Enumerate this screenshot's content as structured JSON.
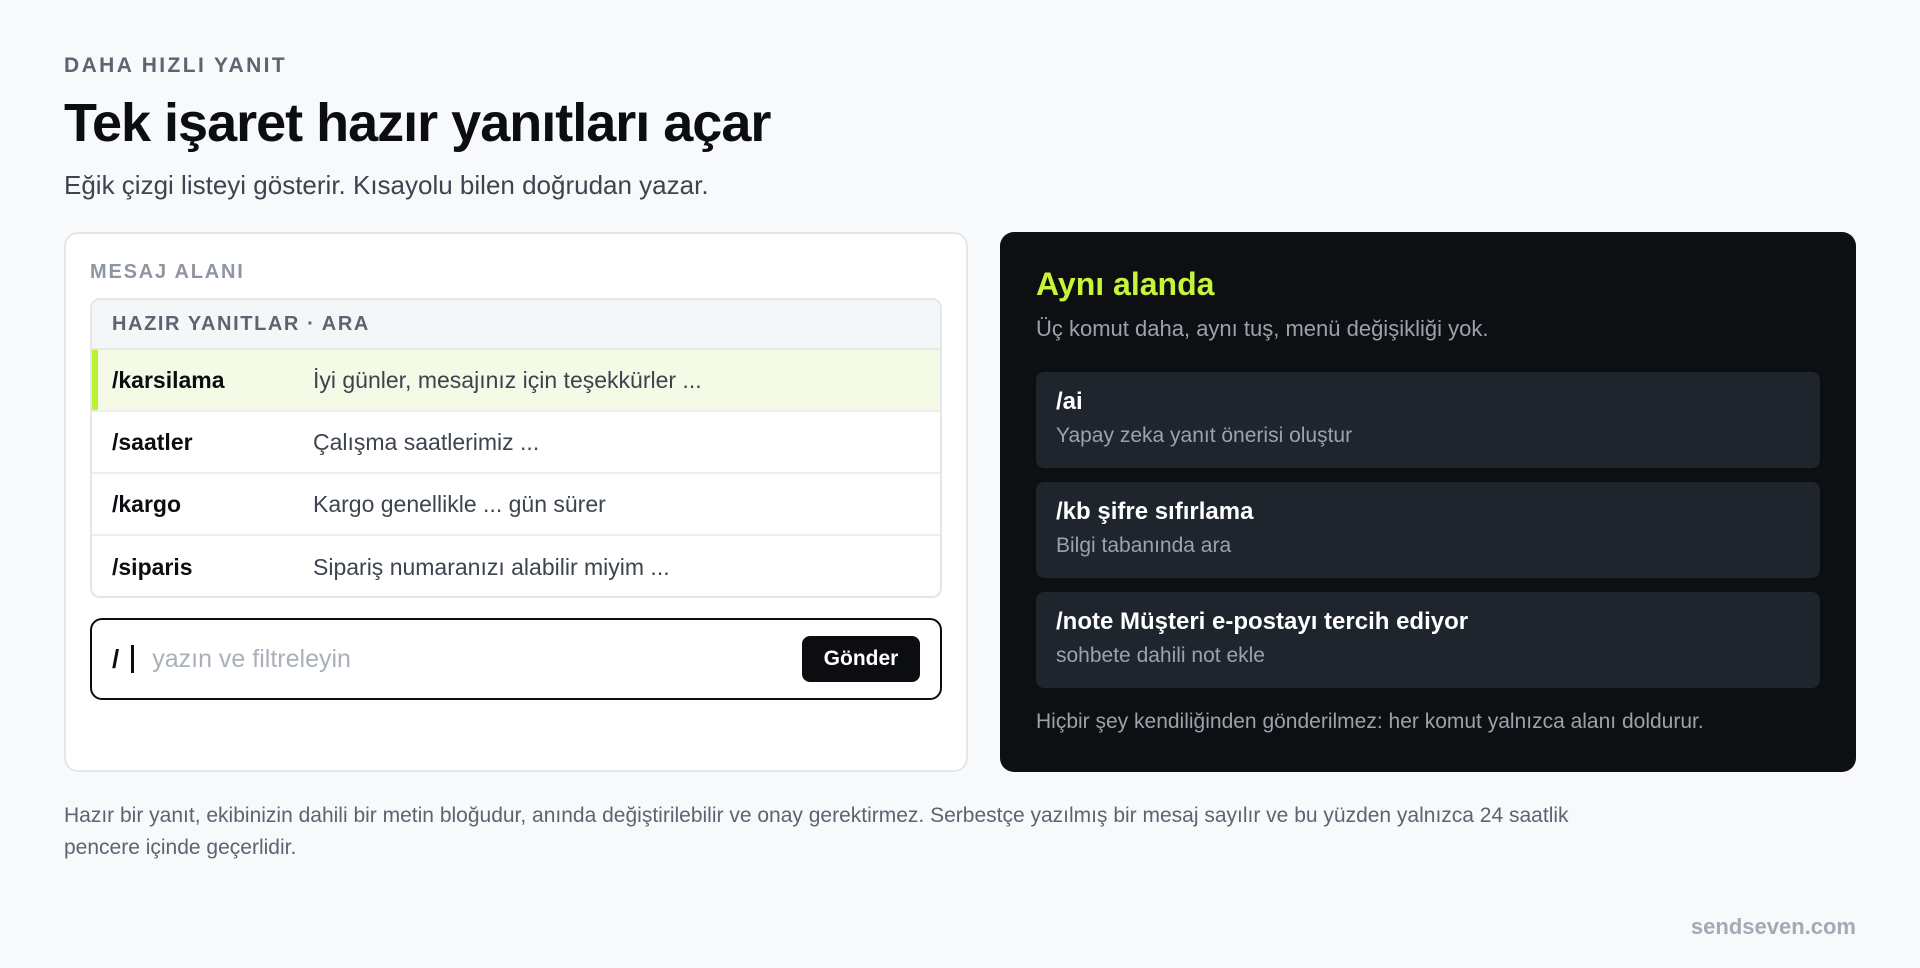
{
  "header": {
    "eyebrow": "DAHA HIZLI YANIT",
    "title": "Tek işaret hazır yanıtları açar",
    "subtitle": "Eğik çizgi listeyi gösterir. Kısayolu bilen doğrudan yazar."
  },
  "message_area": {
    "label": "MESAJ ALANI",
    "list_header": "HAZIR YANITLAR · ARA",
    "replies": [
      {
        "command": "/karsilama",
        "text": "İyi günler, mesajınız için teşekkürler ...",
        "active": true
      },
      {
        "command": "/saatler",
        "text": "Çalışma saatlerimiz ...",
        "active": false
      },
      {
        "command": "/kargo",
        "text": "Kargo genellikle ... gün sürer",
        "active": false
      },
      {
        "command": "/siparis",
        "text": "Sipariş numaranızı alabilir miyim ...",
        "active": false
      }
    ],
    "composer": {
      "prefix": "/",
      "value": "",
      "placeholder": "yazın ve filtreleyin",
      "send_label": "Gönder"
    }
  },
  "same_field": {
    "title": "Aynı alanda",
    "subtitle": "Üç komut daha, aynı tuş, menü değişikliği yok.",
    "commands": [
      {
        "name": "/ai",
        "description": "Yapay zeka yanıt önerisi oluştur"
      },
      {
        "name": "/kb şifre sıfırlama",
        "description": "Bilgi tabanında ara"
      },
      {
        "name": "/note Müşteri e-postayı tercih ediyor",
        "description": "sohbete dahili not ekle"
      }
    ],
    "footer": "Hiçbir şey kendiliğinden gönderilmez: her komut yalnızca alanı doldurur."
  },
  "footnote": "Hazır bir yanıt, ekibinizin dahili bir metin bloğudur, anında değiştirilebilir ve onay gerektirmez. Serbestçe yazılmış bir mesaj sayılır ve bu yüzden yalnızca 24 saatlik pencere içinde geçerlidir.",
  "brand": "sendseven.com",
  "colors": {
    "accent": "#c6f43a",
    "active_row_bg": "#f4fae6",
    "dark_panel": "#0d0f12",
    "command_card": "#1f252d"
  }
}
